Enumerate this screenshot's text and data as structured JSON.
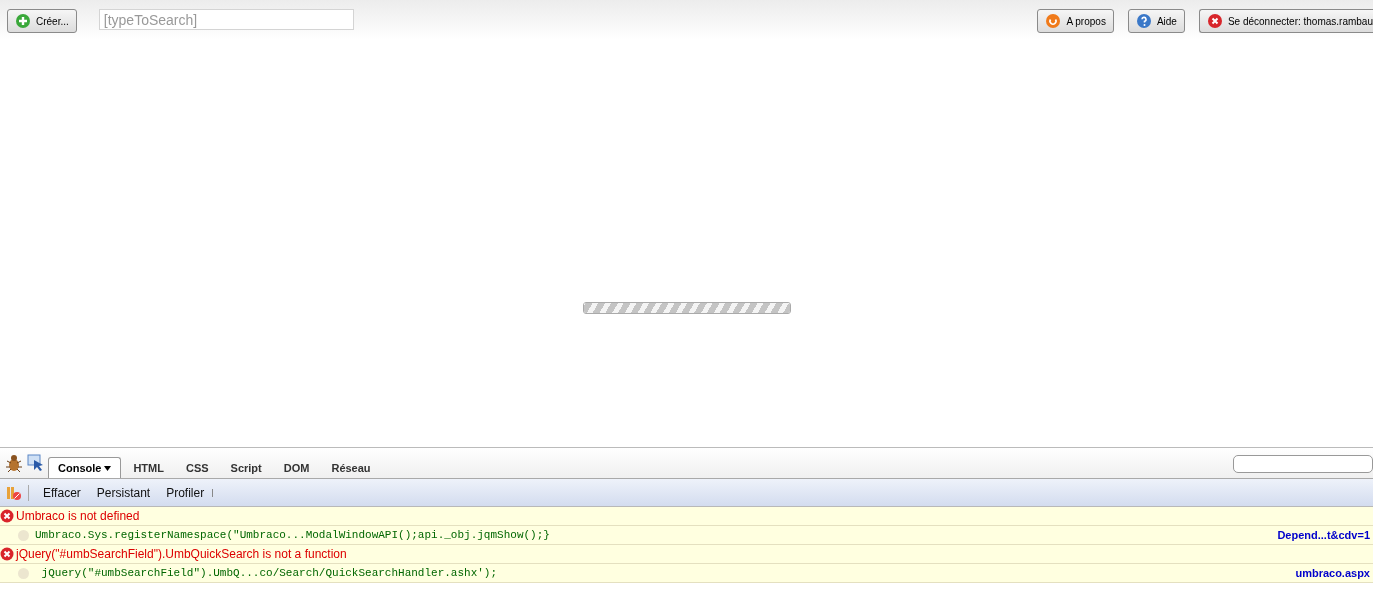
{
  "toolbar": {
    "create_button": "Créer...",
    "search": {
      "placeholder": "[typeToSearch]"
    },
    "buttons": [
      {
        "label": "A propos",
        "kind": "about"
      },
      {
        "label": "Aide",
        "kind": "help"
      },
      {
        "label": "Se déconnecter: thomas.rambau",
        "kind": "logout"
      }
    ]
  },
  "loading": {
    "level": 1
  },
  "devtools": {
    "tabs": [
      {
        "label": "Console",
        "selected": true,
        "dropdown": true
      },
      {
        "label": "HTML",
        "selected": false,
        "dropdown": false
      },
      {
        "label": "CSS",
        "selected": false,
        "dropdown": false
      },
      {
        "label": "Script",
        "selected": false,
        "dropdown": false
      },
      {
        "label": "DOM",
        "selected": false,
        "dropdown": false
      },
      {
        "label": "Réseau",
        "selected": false,
        "dropdown": false
      }
    ],
    "console_toolbar": [
      "Effacer",
      "Persistant",
      "Profiler"
    ],
    "messages": [
      {
        "error": "Umbraco is not defined",
        "code": "Umbraco.Sys.registerNamespace(\"Umbraco...ModalWindowAPI();api._obj.jqmShow();}",
        "source": "Depend...t&cdv=1"
      },
      {
        "error": "jQuery(\"#umbSearchField\").UmbQuickSearch is not a function",
        "code": " jQuery(\"#umbSearchField\").UmbQ...co/Search/QuickSearchHandler.ashx');",
        "source": "umbraco.aspx"
      }
    ]
  }
}
